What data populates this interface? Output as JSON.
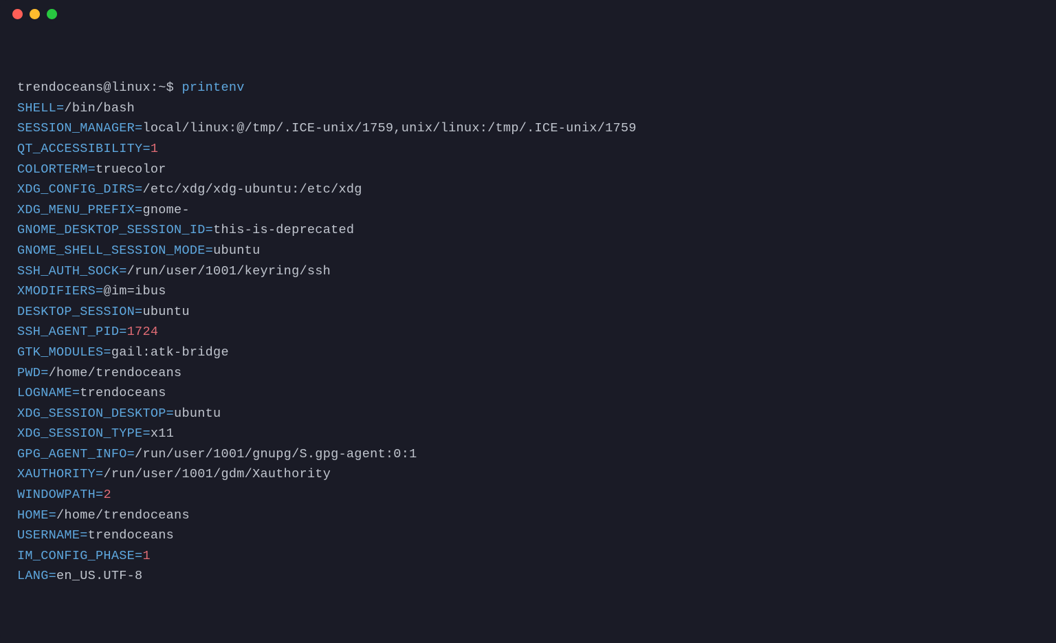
{
  "prompt": {
    "host": "trendoceans@linux:~$ ",
    "command": "printenv"
  },
  "env": [
    {
      "name": "SHELL",
      "value": "/bin/bash",
      "numeric": false
    },
    {
      "name": "SESSION_MANAGER",
      "value": "local/linux:@/tmp/.ICE-unix/1759,unix/linux:/tmp/.ICE-unix/1759",
      "numeric": false
    },
    {
      "name": "QT_ACCESSIBILITY",
      "value": "1",
      "numeric": true
    },
    {
      "name": "COLORTERM",
      "value": "truecolor",
      "numeric": false
    },
    {
      "name": "XDG_CONFIG_DIRS",
      "value": "/etc/xdg/xdg-ubuntu:/etc/xdg",
      "numeric": false
    },
    {
      "name": "XDG_MENU_PREFIX",
      "value": "gnome-",
      "numeric": false
    },
    {
      "name": "GNOME_DESKTOP_SESSION_ID",
      "value": "this-is-deprecated",
      "numeric": false
    },
    {
      "name": "GNOME_SHELL_SESSION_MODE",
      "value": "ubuntu",
      "numeric": false
    },
    {
      "name": "SSH_AUTH_SOCK",
      "value": "/run/user/1001/keyring/ssh",
      "numeric": false
    },
    {
      "name": "XMODIFIERS",
      "value": "@im=ibus",
      "numeric": false
    },
    {
      "name": "DESKTOP_SESSION",
      "value": "ubuntu",
      "numeric": false
    },
    {
      "name": "SSH_AGENT_PID",
      "value": "1724",
      "numeric": true
    },
    {
      "name": "GTK_MODULES",
      "value": "gail:atk-bridge",
      "numeric": false
    },
    {
      "name": "PWD",
      "value": "/home/trendoceans",
      "numeric": false
    },
    {
      "name": "LOGNAME",
      "value": "trendoceans",
      "numeric": false
    },
    {
      "name": "XDG_SESSION_DESKTOP",
      "value": "ubuntu",
      "numeric": false
    },
    {
      "name": "XDG_SESSION_TYPE",
      "value": "x11",
      "numeric": false
    },
    {
      "name": "GPG_AGENT_INFO",
      "value": "/run/user/1001/gnupg/S.gpg-agent:0:1",
      "numeric": false
    },
    {
      "name": "XAUTHORITY",
      "value": "/run/user/1001/gdm/Xauthority",
      "numeric": false
    },
    {
      "name": "WINDOWPATH",
      "value": "2",
      "numeric": true
    },
    {
      "name": "HOME",
      "value": "/home/trendoceans",
      "numeric": false
    },
    {
      "name": "USERNAME",
      "value": "trendoceans",
      "numeric": false
    },
    {
      "name": "IM_CONFIG_PHASE",
      "value": "1",
      "numeric": true
    },
    {
      "name": "LANG",
      "value": "en_US.UTF-8",
      "numeric": false
    }
  ]
}
